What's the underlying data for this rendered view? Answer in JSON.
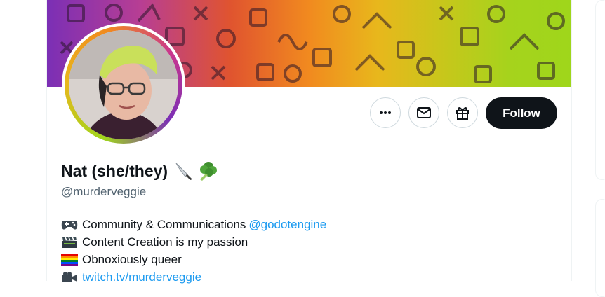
{
  "profile": {
    "display_name": "Nat (she/they)",
    "name_emojis": [
      "knife-icon",
      "broccoli-icon"
    ],
    "handle": "@murderveggie"
  },
  "actions": {
    "more_icon": "more-horizontal-icon",
    "message_icon": "envelope-icon",
    "gift_icon": "gift-icon",
    "follow_label": "Follow"
  },
  "bio": {
    "line1_text": "Community & Communications ",
    "line1_link": "@godotengine",
    "line2_text": "Content Creation is my passion",
    "line3_text": "Obnoxiously queer",
    "line4_link": "twitch.tv/murderveggie",
    "icons": [
      "gamepad-icon",
      "clapperboard-icon",
      "rainbow-flag-icon",
      "camera-icon"
    ]
  },
  "colors": {
    "link": "#1d9bf0",
    "follow_bg": "#0f1419",
    "handle": "#536471"
  }
}
